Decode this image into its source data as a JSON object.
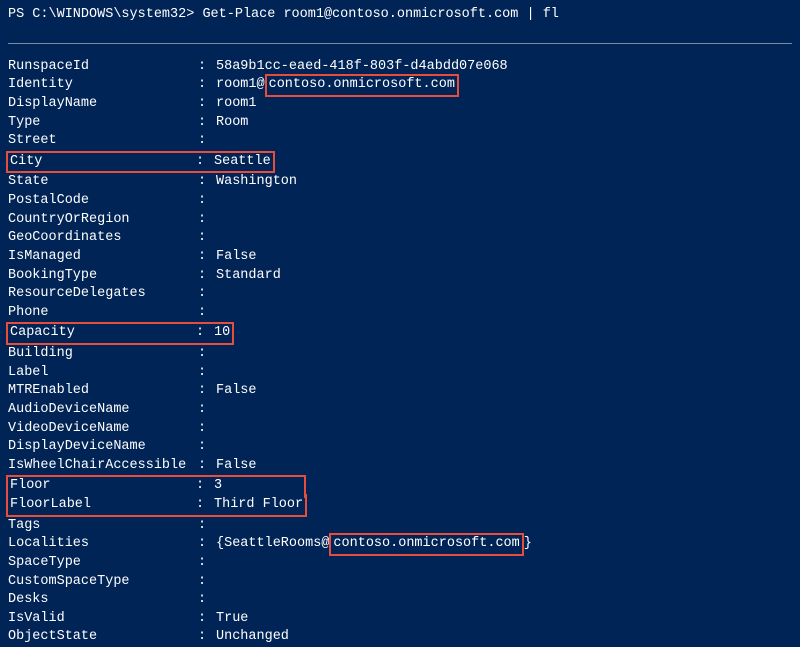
{
  "prompt": {
    "prefix": "PS C:\\WINDOWS\\system32> ",
    "command": "Get-Place room1@contoso.onmicrosoft.com | fl"
  },
  "output": {
    "RunspaceId": {
      "key": "RunspaceId",
      "value": "58a9b1cc-eaed-418f-803f-d4abdd07e068"
    },
    "Identity": {
      "key": "Identity",
      "value_prefix": "room1@",
      "value_boxed": "contoso.onmicrosoft.com"
    },
    "DisplayName": {
      "key": "DisplayName",
      "value": "room1"
    },
    "Type": {
      "key": "Type",
      "value": "Room"
    },
    "Street": {
      "key": "Street",
      "value": ""
    },
    "City": {
      "key": "City",
      "value": "Seattle"
    },
    "State": {
      "key": "State",
      "value": "Washington"
    },
    "PostalCode": {
      "key": "PostalCode",
      "value": ""
    },
    "CountryOrRegion": {
      "key": "CountryOrRegion",
      "value": ""
    },
    "GeoCoordinates": {
      "key": "GeoCoordinates",
      "value": ""
    },
    "IsManaged": {
      "key": "IsManaged",
      "value": "False"
    },
    "BookingType": {
      "key": "BookingType",
      "value": "Standard"
    },
    "ResourceDelegates": {
      "key": "ResourceDelegates",
      "value": ""
    },
    "Phone": {
      "key": "Phone",
      "value": ""
    },
    "Capacity": {
      "key": "Capacity",
      "value": "10"
    },
    "Building": {
      "key": "Building",
      "value": ""
    },
    "Label": {
      "key": "Label",
      "value": ""
    },
    "MTREnabled": {
      "key": "MTREnabled",
      "value": "False"
    },
    "AudioDeviceName": {
      "key": "AudioDeviceName",
      "value": ""
    },
    "VideoDeviceName": {
      "key": "VideoDeviceName",
      "value": ""
    },
    "DisplayDeviceName": {
      "key": "DisplayDeviceName",
      "value": ""
    },
    "IsWheelChairAccessible": {
      "key": "IsWheelChairAccessible",
      "value": "False"
    },
    "Floor": {
      "key": "Floor",
      "value": "3"
    },
    "FloorLabel": {
      "key": "FloorLabel",
      "value": "Third Floor"
    },
    "Tags": {
      "key": "Tags",
      "value": ""
    },
    "Localities": {
      "key": "Localities",
      "value_prefix": "{SeattleRooms@",
      "value_boxed": "contoso.onmicrosoft.com",
      "value_suffix": "}"
    },
    "SpaceType": {
      "key": "SpaceType",
      "value": ""
    },
    "CustomSpaceType": {
      "key": "CustomSpaceType",
      "value": ""
    },
    "Desks": {
      "key": "Desks",
      "value": ""
    },
    "IsValid": {
      "key": "IsValid",
      "value": "True"
    },
    "ObjectState": {
      "key": "ObjectState",
      "value": "Unchanged"
    }
  }
}
